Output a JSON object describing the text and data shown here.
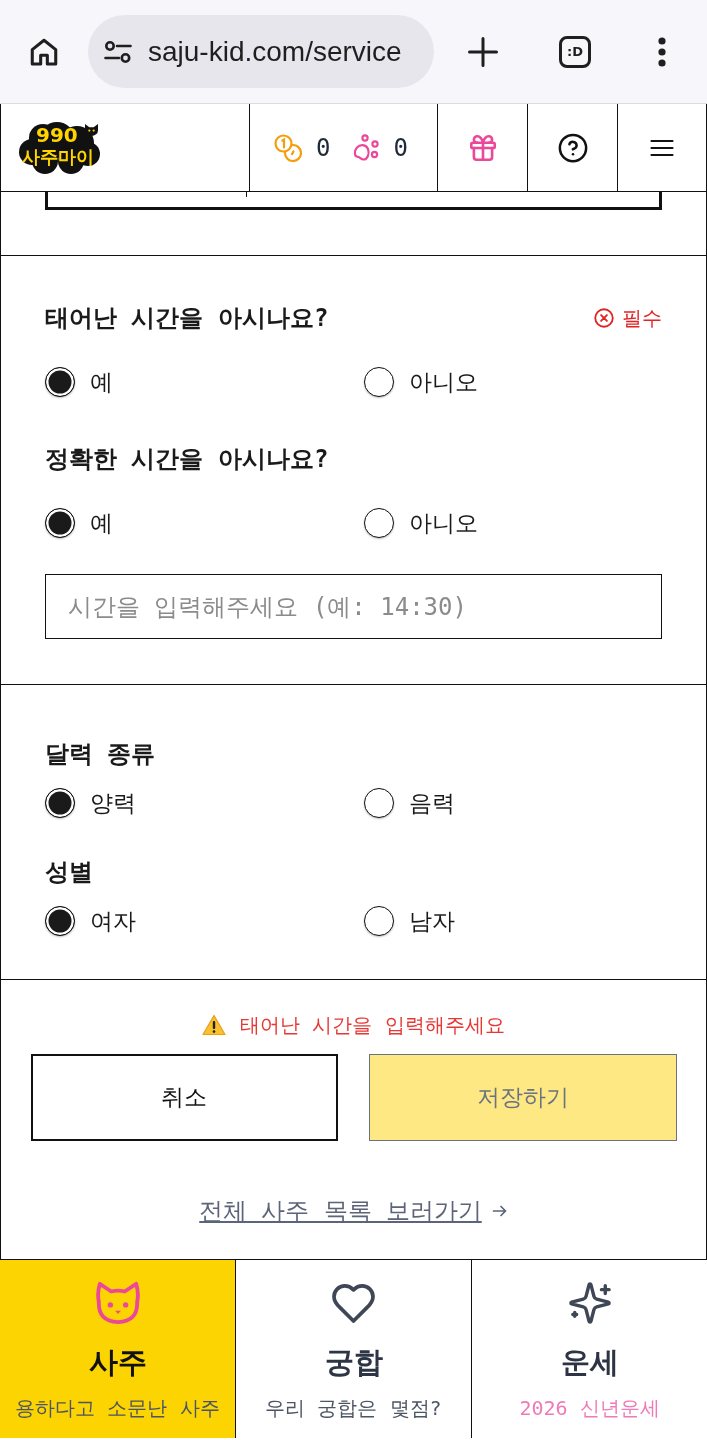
{
  "browser": {
    "url": "saju-kid.com/service",
    "tab_count": ":D"
  },
  "header": {
    "logo": {
      "number": "990",
      "name": "사주마이"
    },
    "coins": "0",
    "paws": "0"
  },
  "time_section": {
    "questions": [
      {
        "label": "태어난 시간을 아시나요?",
        "required": "필수",
        "options": [
          {
            "label": "예",
            "selected": true
          },
          {
            "label": "아니오",
            "selected": false
          }
        ]
      },
      {
        "label": "정확한 시간을 아시나요?",
        "options": [
          {
            "label": "예",
            "selected": true
          },
          {
            "label": "아니오",
            "selected": false
          }
        ]
      }
    ],
    "time_input": {
      "placeholder": "시간을 입력해주세요 (예: 14:30)"
    }
  },
  "detail_section": {
    "groups": [
      {
        "label": "달력 종류",
        "options": [
          {
            "label": "양력",
            "selected": true
          },
          {
            "label": "음력",
            "selected": false
          }
        ]
      },
      {
        "label": "성별",
        "options": [
          {
            "label": "여자",
            "selected": true
          },
          {
            "label": "남자",
            "selected": false
          }
        ]
      }
    ]
  },
  "actions": {
    "warning": "태어난 시간을 입력해주세요",
    "buttons": [
      {
        "label": "취소",
        "kind": "secondary",
        "disabled": false
      },
      {
        "label": "저장하기",
        "kind": "primary",
        "disabled": true
      }
    ],
    "link": "전체 사주 목록 보러가기"
  },
  "bottom_nav": [
    {
      "title": "사주",
      "subtitle": "용하다고 소문난 사주",
      "selected": true,
      "highlighted": false
    },
    {
      "title": "궁합",
      "subtitle": "우리 궁합은 몇점?",
      "selected": false,
      "highlighted": false
    },
    {
      "title": "운세",
      "subtitle": "2026 신년운세",
      "selected": false,
      "highlighted": true
    }
  ]
}
